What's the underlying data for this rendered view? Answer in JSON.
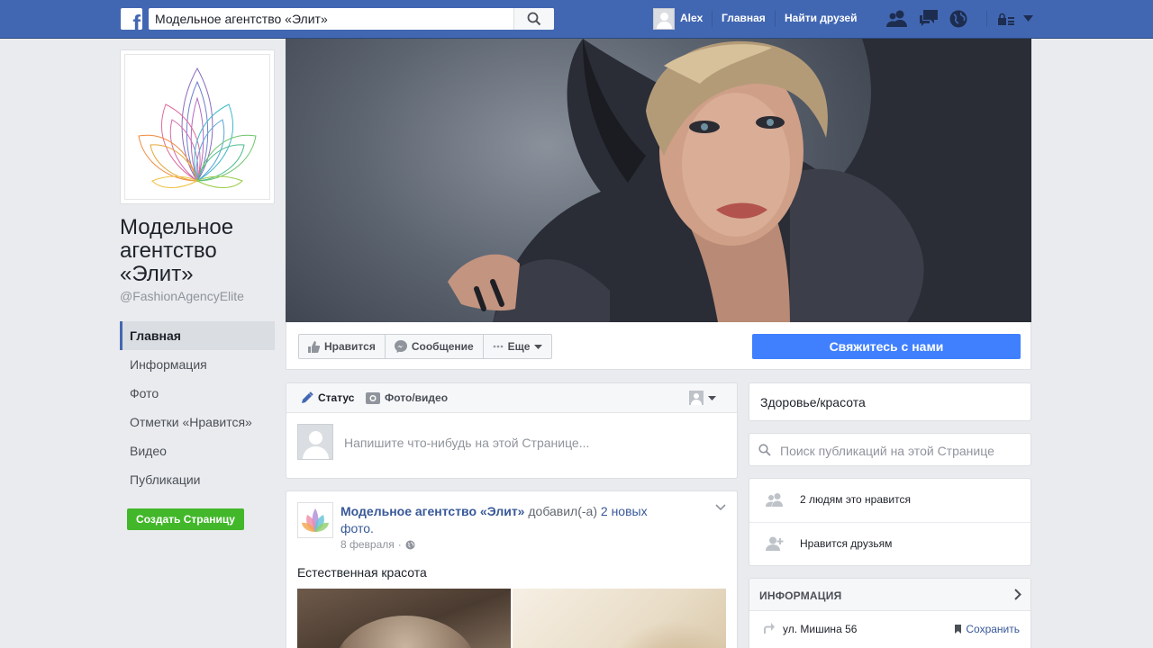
{
  "topbar": {
    "logo": "facebook-logo",
    "search_value": "Модельное агентство «Элит»",
    "user_name": "Alex",
    "home_label": "Главная",
    "find_friends_label": "Найти друзей"
  },
  "page": {
    "name": "Модельное агентство «Элит»",
    "handle": "@FashionAgencyElite"
  },
  "left_nav": {
    "items": [
      {
        "label": "Главная",
        "active": true
      },
      {
        "label": "Информация"
      },
      {
        "label": "Фото"
      },
      {
        "label": "Отметки «Нравится»"
      },
      {
        "label": "Видео"
      },
      {
        "label": "Публикации"
      }
    ],
    "create_page_label": "Создать Страницу"
  },
  "actions": {
    "like_label": "Нравится",
    "message_label": "Сообщение",
    "more_label": "Еще",
    "contact_label": "Свяжитесь с нами"
  },
  "composer": {
    "tab_status": "Статус",
    "tab_photo": "Фото/видео",
    "placeholder": "Напишите что-нибудь на этой Странице..."
  },
  "post": {
    "author": "Модельное агентство «Элит»",
    "action_text": "добавил(-а)",
    "link_text": "2 новых фото",
    "date": "8 февраля",
    "text": "Естественная красота"
  },
  "right": {
    "category": "Здоровье/красота",
    "search_placeholder": "Поиск публикаций на этой Странице",
    "likes_count_text": "2 людям это нравится",
    "friends_like_text": "Нравится друзьям",
    "info_title": "ИНФОРМАЦИЯ",
    "address": "ул. Мишина 56",
    "save_label": "Сохранить"
  },
  "colors": {
    "brand_blue": "#4267b2",
    "primary_button": "#4080ff",
    "green_button": "#42b72a",
    "link": "#385898"
  }
}
